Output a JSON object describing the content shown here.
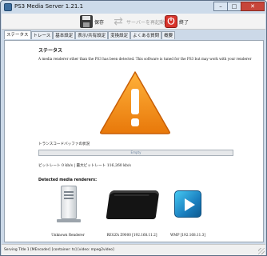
{
  "window": {
    "title": "PS3 Media Server 1.21.1",
    "minimize_glyph": "–",
    "maximize_glyph": "□",
    "close_glyph": "✕"
  },
  "toolbar": {
    "save_label": "保存",
    "restart_label": "サーバーを再起動",
    "quit_label": "終了",
    "save_icon": "floppy-disk-icon",
    "restart_icon": "restart-arrows-icon",
    "quit_icon": "power-icon"
  },
  "tabs": [
    {
      "label": "ステータス",
      "active": true
    },
    {
      "label": "トレース",
      "active": false
    },
    {
      "label": "基本設定",
      "active": false
    },
    {
      "label": "表示/共有設定",
      "active": false
    },
    {
      "label": "変換設定",
      "active": false
    },
    {
      "label": "よくある質問",
      "active": false
    },
    {
      "label": "概要",
      "active": false
    }
  ],
  "status": {
    "heading": "ステータス",
    "message": "A media renderer other than the PS3 has been detected. This software is tuned for the PS3 but may work with your renderer"
  },
  "buffer": {
    "label": "トランスコードバッファの状況",
    "value_text": "Empty",
    "fill_percent": 0
  },
  "bitrate": {
    "text": "ビットレート 0 kb/s | 最大ビットレート 116,260 kb/s"
  },
  "renderers": {
    "heading": "Detected media renderers:",
    "items": [
      {
        "label": "Unknown Renderer",
        "icon": "pc-tower-icon"
      },
      {
        "label": "REGZA Z9000 [192.168.11.2]",
        "icon": "ps3-console-icon"
      },
      {
        "label": "WMP [192.168.11.3]",
        "icon": "windows-media-player-icon"
      }
    ]
  },
  "statusbar": {
    "text": "Serving Title 1 [MEncoder] [container: ts] [video: mpeg2video]"
  },
  "colors": {
    "warning_orange": "#f28a14",
    "warning_orange_dark": "#c85e05",
    "window_frame": "#ccd9e8",
    "quit_red": "#d8342b"
  }
}
